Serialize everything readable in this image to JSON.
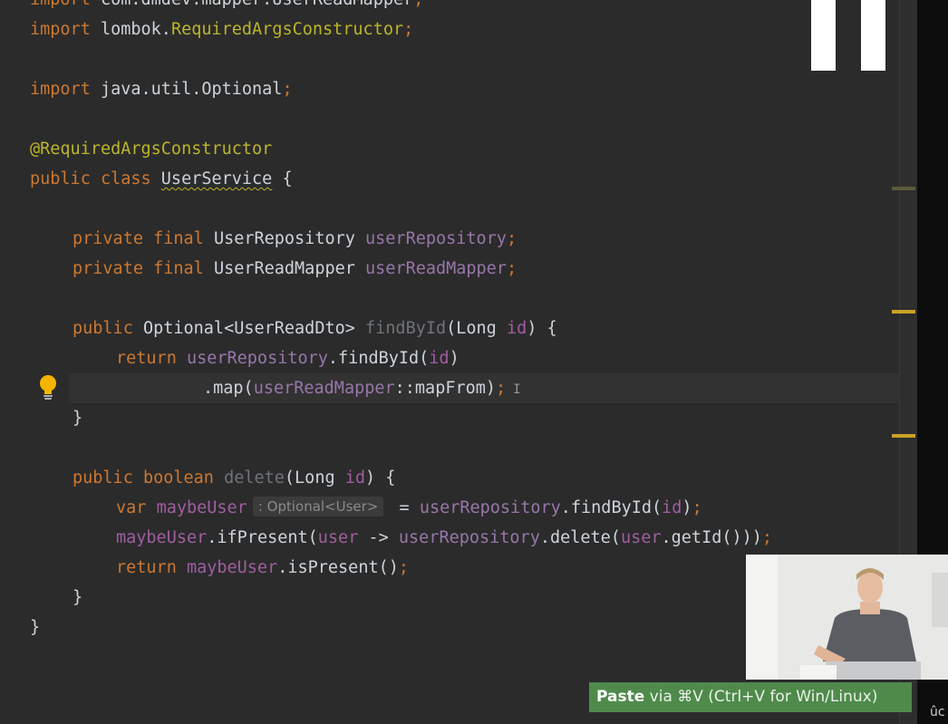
{
  "editor": {
    "lines": {
      "l0": [
        "import",
        " com.dmdev.mapper.UserReadMapper",
        ";"
      ],
      "l1": [
        "import",
        " lombok.",
        "RequiredArgsConstructor",
        ";"
      ],
      "l3": [
        "import",
        " java.util.Optional",
        ";"
      ],
      "l5": [
        "@RequiredArgsConstructor"
      ],
      "l6": [
        "public class ",
        "UserService",
        " {"
      ],
      "l8": [
        "private final ",
        "UserRepository ",
        "userRepository",
        ";"
      ],
      "l9": [
        "private final ",
        "UserReadMapper ",
        "userReadMapper",
        ";"
      ],
      "l11": [
        "public ",
        "Optional<UserReadDto> ",
        "findById",
        "(Long ",
        "id",
        ") {"
      ],
      "l12": [
        "return ",
        "userRepository",
        ".findById(",
        "id",
        ")"
      ],
      "l13": [
        ".map(",
        "userReadMapper",
        "::mapFrom)",
        ";"
      ],
      "l14": [
        "}"
      ],
      "l16": [
        "public boolean ",
        "delete",
        "(Long ",
        "id",
        ") {"
      ],
      "l17": [
        "var ",
        "maybeUser",
        ": Optional<User>",
        " = ",
        "userRepository",
        ".findById(",
        "id",
        ")",
        ";"
      ],
      "l18": [
        "maybeUser",
        ".ifPresent(",
        "user",
        " -> ",
        "userRepository",
        ".delete(",
        "user",
        ".getId()))",
        ";"
      ],
      "l19": [
        "return ",
        "maybeUser",
        ".isPresent()",
        ";"
      ],
      "l20": [
        "}"
      ],
      "l21": [
        "}"
      ]
    },
    "cursor_glyph": "I",
    "intention_icon": "lightbulb-icon"
  },
  "paste_hint": {
    "action": "Paste",
    "rest": " via ⌘V (Ctrl+V for Win/Linux)"
  },
  "corner_text": "ûc",
  "colors": {
    "background": "#2b2b2b",
    "keyword": "#cc7832",
    "annotation": "#bbb529",
    "field": "#9876aa",
    "text": "#cdd4db",
    "hint_bg": "#4f8a4b",
    "marker": "#c9a227"
  }
}
